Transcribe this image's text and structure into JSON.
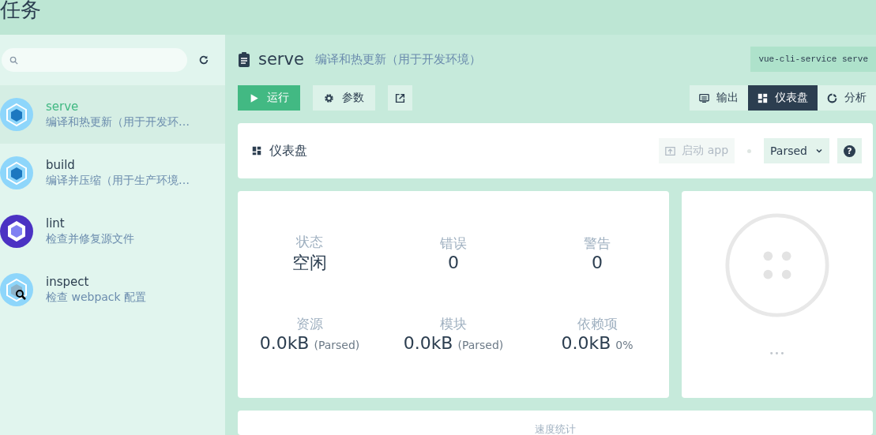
{
  "header": {
    "title": "任务"
  },
  "sidebar": {
    "tasks": [
      {
        "name": "serve",
        "description": "编译和热更新（用于开发环…",
        "selected": true
      },
      {
        "name": "build",
        "description": "编译并压缩（用于生产环境…",
        "selected": false
      },
      {
        "name": "lint",
        "description": "检查并修复源文件",
        "selected": false
      },
      {
        "name": "inspect",
        "description": "检查 webpack 配置",
        "selected": false
      }
    ]
  },
  "task": {
    "name": "serve",
    "description": "编译和热更新（用于开发环境）",
    "command": "vue-cli-service serve"
  },
  "toolbar": {
    "run": "运行",
    "params": "参数",
    "views": [
      {
        "label": "输出",
        "selected": false
      },
      {
        "label": "仪表盘",
        "selected": true
      },
      {
        "label": "分析",
        "selected": false
      }
    ]
  },
  "dashboard": {
    "title": "仪表盘",
    "launch_app": "启动 app",
    "mode": "Parsed",
    "help": "?"
  },
  "stats": [
    {
      "label": "状态",
      "value": "空闲"
    },
    {
      "label": "错误",
      "value": "0"
    },
    {
      "label": "警告",
      "value": "0"
    },
    {
      "label": "资源",
      "value": "0.0kB",
      "suffix": "(Parsed)"
    },
    {
      "label": "模块",
      "value": "0.0kB",
      "suffix": "(Parsed)"
    },
    {
      "label": "依赖项",
      "value": "0.0kB",
      "suffix": "0%"
    }
  ],
  "progress": {
    "dots": "•••"
  },
  "speed": {
    "title": "速度统计"
  }
}
